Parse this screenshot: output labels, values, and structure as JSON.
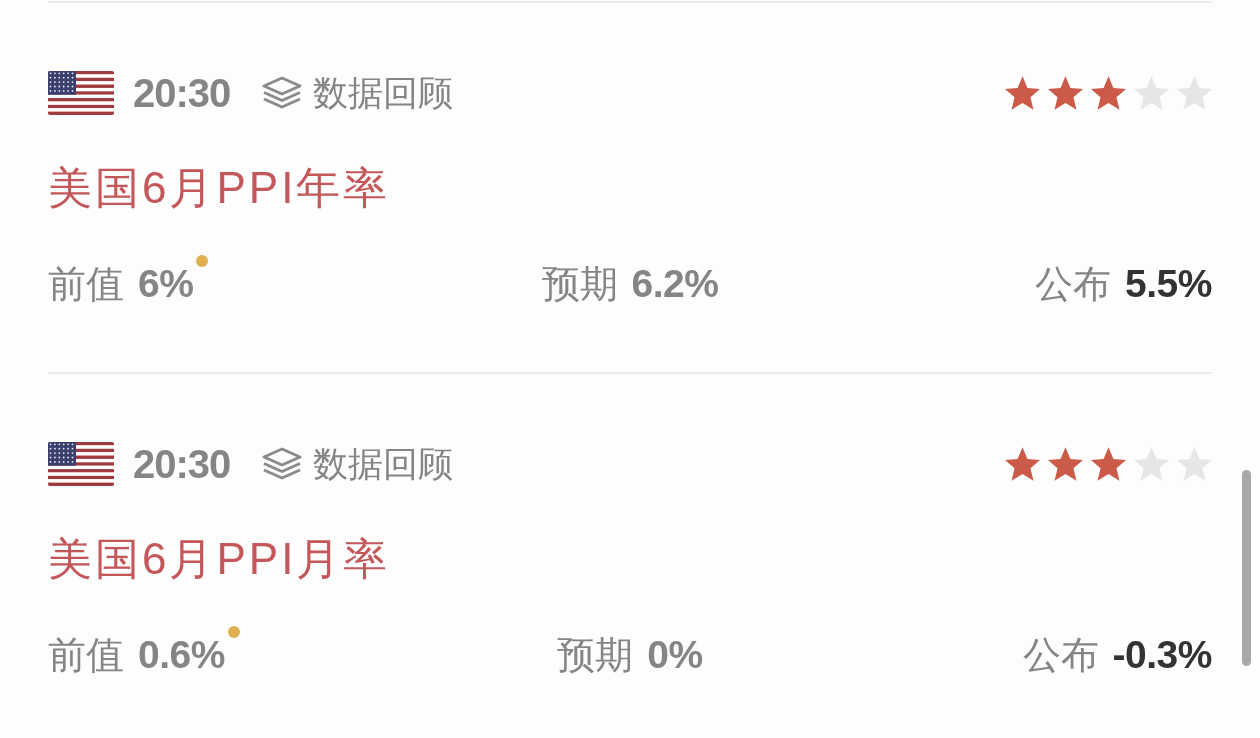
{
  "events": [
    {
      "time": "20:30",
      "tag": "数据回顾",
      "stars": 3,
      "title": "美国6月PPI年率",
      "previous": {
        "label": "前值",
        "value": "6%",
        "revised": true
      },
      "forecast": {
        "label": "预期",
        "value": "6.2%"
      },
      "actual": {
        "label": "公布",
        "value": "5.5%"
      }
    },
    {
      "time": "20:30",
      "tag": "数据回顾",
      "stars": 3,
      "title": "美国6月PPI月率",
      "previous": {
        "label": "前值",
        "value": "0.6%",
        "revised": true
      },
      "forecast": {
        "label": "预期",
        "value": "0%"
      },
      "actual": {
        "label": "公布",
        "value": "-0.3%"
      }
    }
  ]
}
